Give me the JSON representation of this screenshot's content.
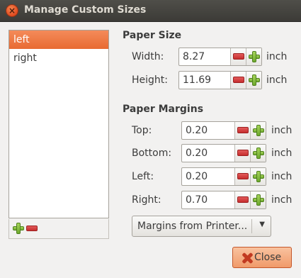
{
  "window": {
    "title": "Manage Custom Sizes"
  },
  "list": {
    "items": [
      {
        "label": "left",
        "selected": true
      },
      {
        "label": "right",
        "selected": false
      }
    ]
  },
  "paper_size": {
    "heading": "Paper Size",
    "width": {
      "label": "Width:",
      "value": "8.27",
      "unit": "inch"
    },
    "height": {
      "label": "Height:",
      "value": "11.69",
      "unit": "inch"
    }
  },
  "paper_margins": {
    "heading": "Paper Margins",
    "top": {
      "label": "Top:",
      "value": "0.20",
      "unit": "inch"
    },
    "bottom": {
      "label": "Bottom:",
      "value": "0.20",
      "unit": "inch"
    },
    "left": {
      "label": "Left:",
      "value": "0.20",
      "unit": "inch"
    },
    "right": {
      "label": "Right:",
      "value": "0.70",
      "unit": "inch"
    }
  },
  "margins_dropdown": {
    "label": "Margins from Printer..."
  },
  "close_button": {
    "label": "Close"
  },
  "colors": {
    "selection": "#e86a32",
    "titlebar": "#3c3b37",
    "close_button": "#f09a6a"
  }
}
